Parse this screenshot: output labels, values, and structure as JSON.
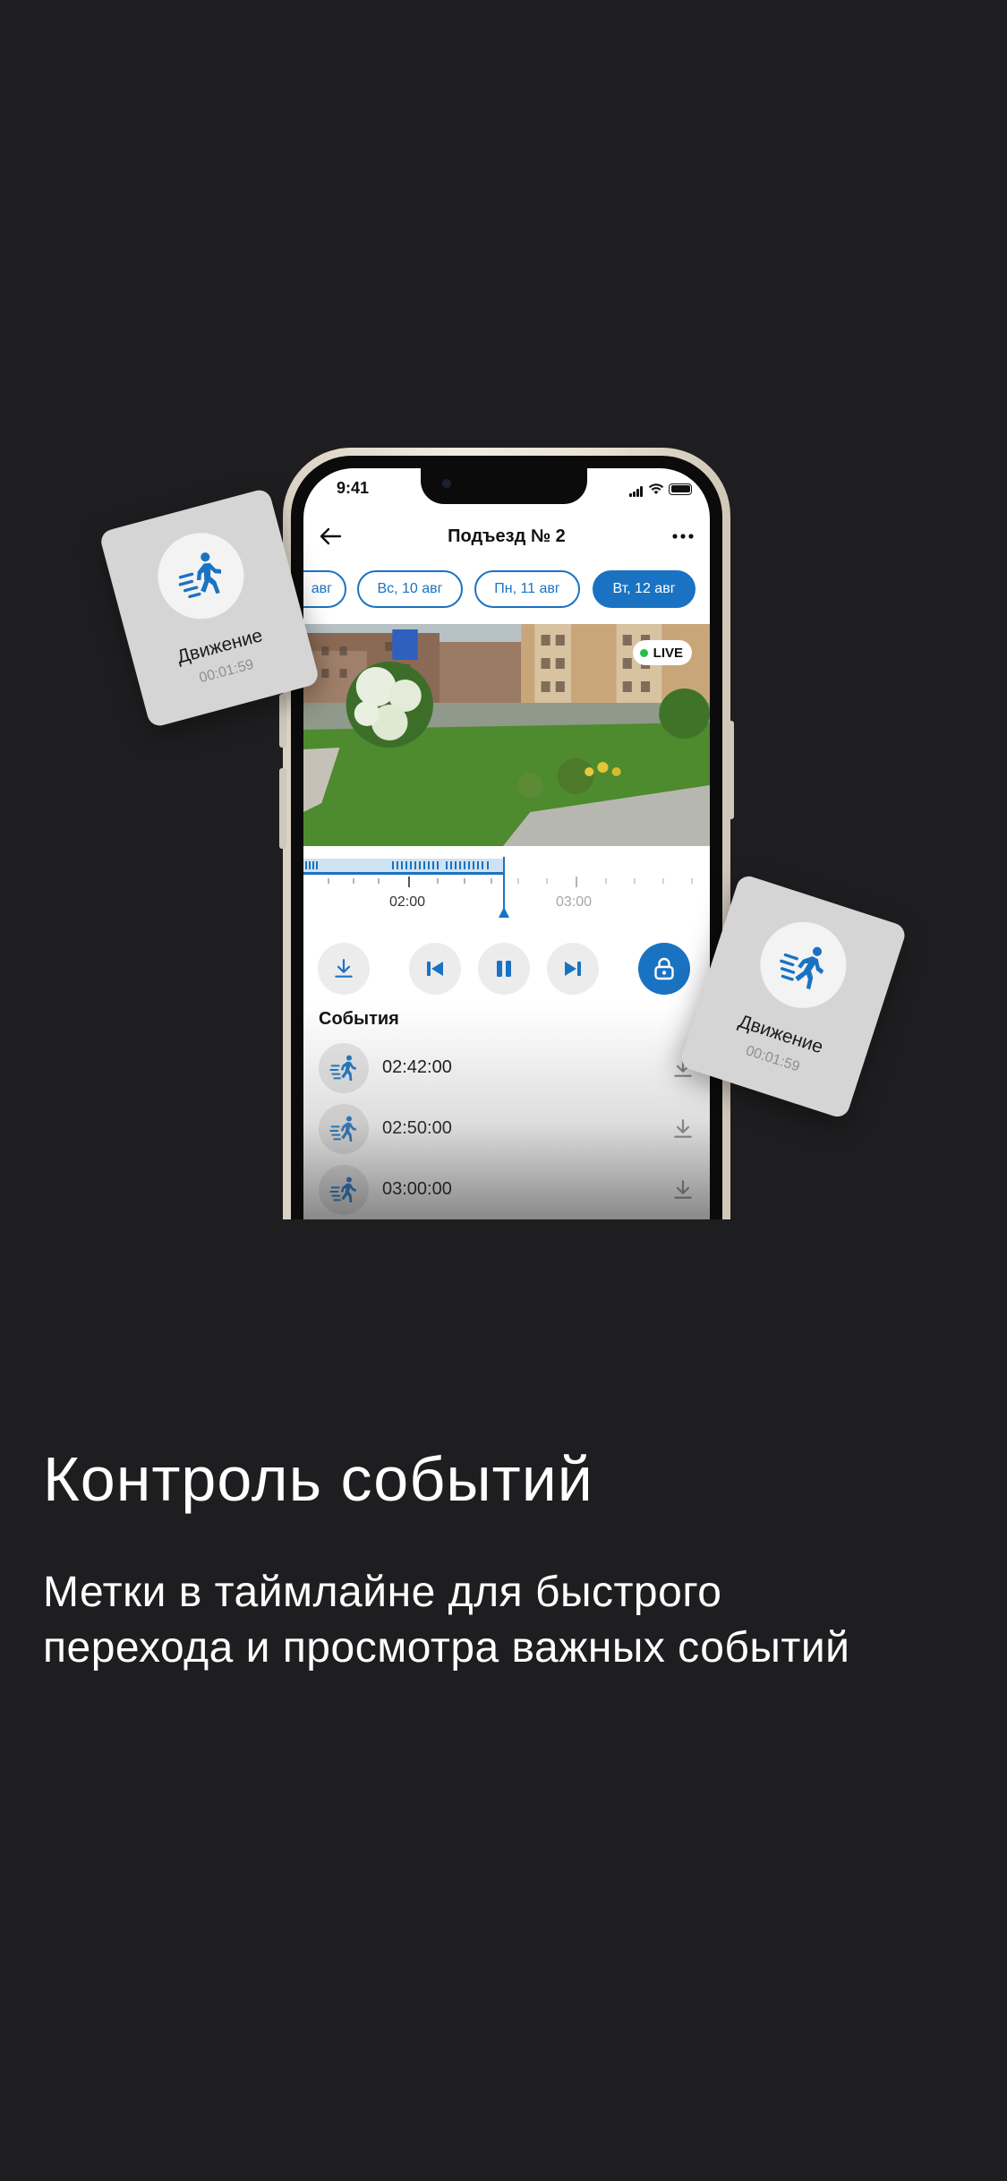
{
  "status_bar": {
    "time": "9:41"
  },
  "header": {
    "title": "Подъезд № 2"
  },
  "date_chips": [
    {
      "label": "авг",
      "active": false
    },
    {
      "label": "Вс, 10 авг",
      "active": false
    },
    {
      "label": "Пн, 11 авг",
      "active": false
    },
    {
      "label": "Вт, 12 авг",
      "active": true
    }
  ],
  "video": {
    "live_label": "LIVE"
  },
  "timeline": {
    "labels": [
      "02:00",
      "03:00"
    ]
  },
  "events": {
    "title": "События",
    "items": [
      {
        "time": "02:42:00",
        "icon": "motion-icon"
      },
      {
        "time": "02:50:00",
        "icon": "motion-icon"
      },
      {
        "time": "03:00:00",
        "icon": "motion-icon"
      }
    ]
  },
  "motion_cards": [
    {
      "title": "Движение",
      "duration": "00:01:59"
    },
    {
      "title": "Движение",
      "duration": "00:01:59"
    }
  ],
  "promo": {
    "headline": "Контроль событий",
    "subtitle_line1": "Метки в таймлайне для быстрого",
    "subtitle_line2": "перехода и просмотра важных событий"
  },
  "colors": {
    "accent": "#1a73c2",
    "background": "#1e1e20",
    "live": "#22c04a"
  }
}
